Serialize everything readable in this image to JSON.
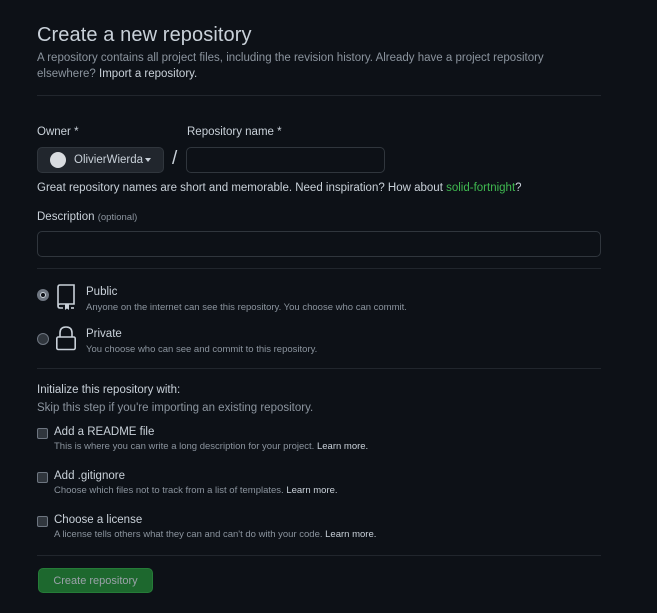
{
  "header": {
    "title": "Create a new repository",
    "subtitle_text": "A repository contains all project files, including the revision history. Already have a project repository elsewhere?",
    "import_link": "Import a repository."
  },
  "owner": {
    "label": "Owner",
    "required_mark": "*",
    "value": "OlivierWierda"
  },
  "repo_name": {
    "label": "Repository name",
    "required_mark": "*",
    "value": "",
    "separator": "/"
  },
  "name_hint": {
    "text": "Great repository names are short and memorable. Need inspiration? How about",
    "suggestion": "solid-fortnight",
    "suffix": "?"
  },
  "description": {
    "label": "Description",
    "optional": "(optional)",
    "value": ""
  },
  "visibility": {
    "selected": "public",
    "options": [
      {
        "title": "Public",
        "desc": "Anyone on the internet can see this repository. You choose who can commit."
      },
      {
        "title": "Private",
        "desc": "You choose who can see and commit to this repository."
      }
    ]
  },
  "initialize": {
    "title": "Initialize this repository with:",
    "subtitle": "Skip this step if you're importing an existing repository.",
    "options": [
      {
        "title": "Add a README file",
        "desc": "This is where you can write a long description for your project.",
        "link": "Learn more."
      },
      {
        "title": "Add .gitignore",
        "desc": "Choose which files not to track from a list of templates.",
        "link": "Learn more."
      },
      {
        "title": "Choose a license",
        "desc": "A license tells others what they can and can't do with your code.",
        "link": "Learn more."
      }
    ]
  },
  "submit": {
    "label": "Create repository"
  },
  "colors": {
    "background": "#0d1117",
    "text": "#c9d1d9",
    "muted": "#8b949e",
    "border": "#30363d",
    "accent_green": "#238636",
    "suggestion_green": "#3fb950"
  },
  "icons": {
    "public": "repo-icon",
    "private": "lock-icon",
    "owner_caret": "chevron-down-icon"
  }
}
